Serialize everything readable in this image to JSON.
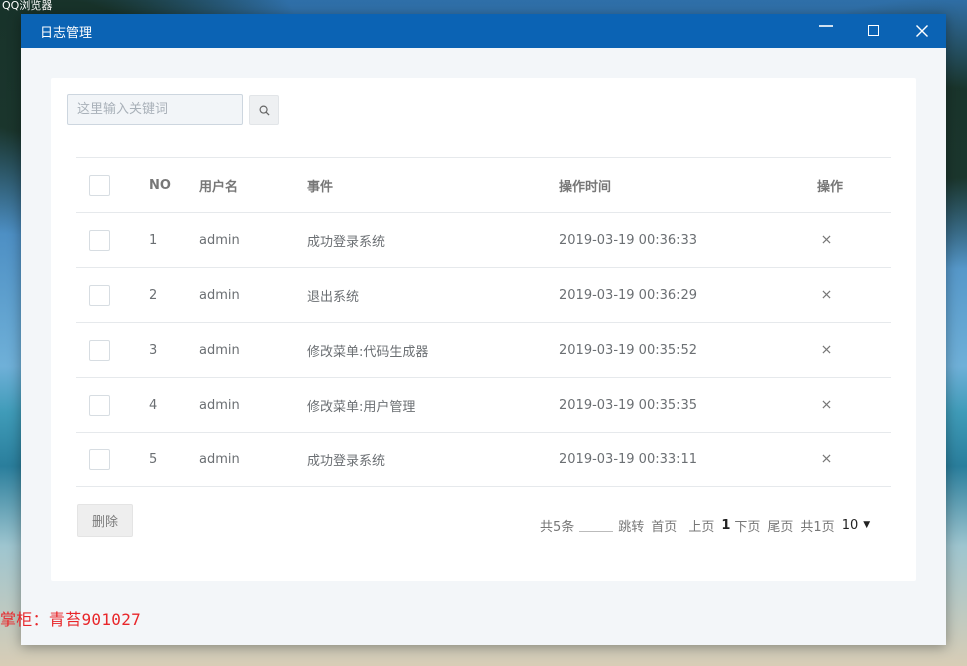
{
  "desktop": {
    "label": "QQ浏览器"
  },
  "window": {
    "title": "日志管理",
    "minimize_icon": "minimize-icon",
    "maximize_icon": "maximize-icon",
    "close_icon": "close-icon"
  },
  "search": {
    "placeholder": "这里输入关键词",
    "value": "",
    "icon": "search-icon"
  },
  "table": {
    "headers": {
      "no": "NO",
      "user": "用户名",
      "event": "事件",
      "time": "操作时间",
      "op": "操作"
    },
    "rows": [
      {
        "no": "1",
        "user": "admin",
        "event": "成功登录系统",
        "time": "2019-03-19 00:36:33"
      },
      {
        "no": "2",
        "user": "admin",
        "event": "退出系统",
        "time": "2019-03-19 00:36:29"
      },
      {
        "no": "3",
        "user": "admin",
        "event": "修改菜单:代码生成器",
        "time": "2019-03-19 00:35:52"
      },
      {
        "no": "4",
        "user": "admin",
        "event": "修改菜单:用户管理",
        "time": "2019-03-19 00:35:35"
      },
      {
        "no": "5",
        "user": "admin",
        "event": "成功登录系统",
        "time": "2019-03-19 00:33:11"
      }
    ]
  },
  "actions": {
    "delete_label": "删除"
  },
  "pagination": {
    "total": "共5条",
    "jump_value": "",
    "jump": "跳转",
    "first": "首页",
    "prev": "上页",
    "current": "1",
    "next": "下页",
    "last": "尾页",
    "pages": "共1页",
    "page_size": "10"
  },
  "watermark": {
    "text": "掌柜：青苔901027"
  },
  "colors": {
    "titlebar": "#0b63b4",
    "watermark": "#e8262a"
  }
}
